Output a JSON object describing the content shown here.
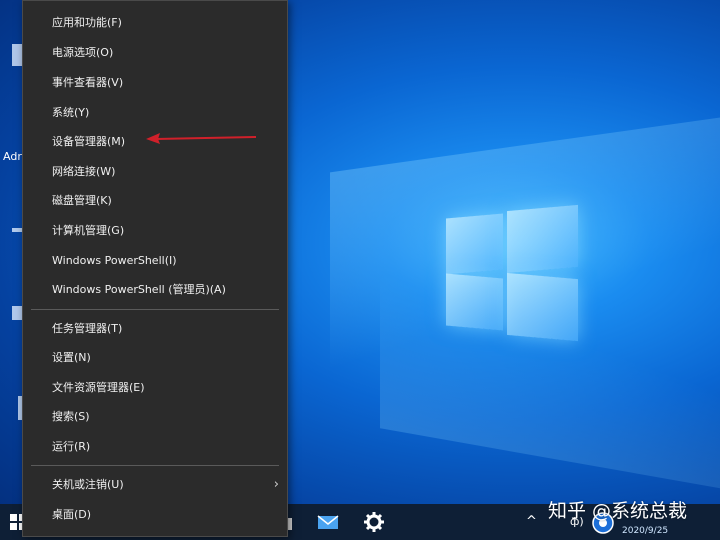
{
  "desktop": {
    "left_icon_text": "Adr"
  },
  "menu": {
    "items": [
      {
        "label": "应用和功能(F)"
      },
      {
        "label": "电源选项(O)"
      },
      {
        "label": "事件查看器(V)"
      },
      {
        "label": "系统(Y)"
      },
      {
        "label": "设备管理器(M)"
      },
      {
        "label": "网络连接(W)"
      },
      {
        "label": "磁盘管理(K)"
      },
      {
        "label": "计算机管理(G)"
      },
      {
        "label": "Windows PowerShell(I)"
      },
      {
        "label": "Windows PowerShell (管理员)(A)"
      },
      {
        "label": "任务管理器(T)"
      },
      {
        "label": "设置(N)"
      },
      {
        "label": "文件资源管理器(E)"
      },
      {
        "label": "搜索(S)"
      },
      {
        "label": "运行(R)"
      },
      {
        "label": "关机或注销(U)"
      },
      {
        "label": "桌面(D)"
      }
    ],
    "highlighted_item": "设备管理器(M)",
    "chevron_icon": "chevron-right-icon"
  },
  "taskbar": {
    "tray_chevron": "^",
    "tray_text": "ф)",
    "clock_date": "2020/9/25"
  },
  "watermark": {
    "text": "知乎 @系统总裁"
  },
  "colors": {
    "menu_bg": "#2b2b2b",
    "arrow": "#d0202a",
    "taskbar_bg": "#0e1f36"
  }
}
